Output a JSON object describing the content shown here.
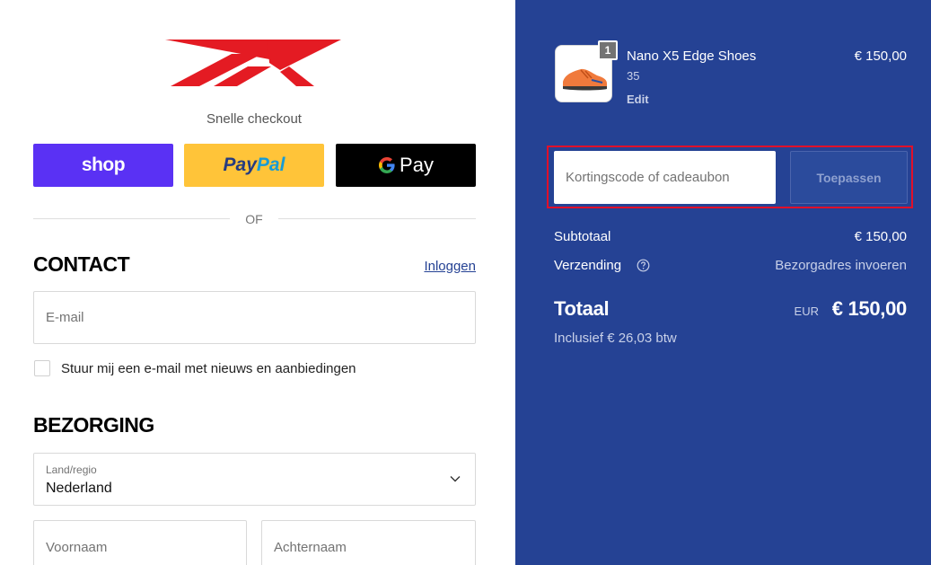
{
  "header": {
    "brand": "Reebok",
    "fast_checkout_label": "Snelle checkout"
  },
  "express_pay": {
    "shop_label": "shop",
    "paypal_label_a": "Pay",
    "paypal_label_b": "Pal",
    "gpay_label": "Pay",
    "or_label": "OF",
    "colors": {
      "shop": "#5a31f4",
      "paypal": "#ffc439",
      "gpay": "#000000"
    }
  },
  "contact": {
    "title": "CONTACT",
    "login_label": "Inloggen",
    "email_placeholder": "E-mail",
    "newsletter_label": "Stuur mij een e-mail met nieuws en aanbiedingen"
  },
  "delivery": {
    "title": "BEZORGING",
    "country_label": "Land/regio",
    "country_value": "Nederland",
    "firstname_placeholder": "Voornaam",
    "lastname_placeholder": "Achternaam"
  },
  "order": {
    "item": {
      "name": "Nano X5 Edge Shoes",
      "variant": "35",
      "edit_label": "Edit",
      "price": "€ 150,00",
      "quantity": "1"
    },
    "discount": {
      "placeholder": "Kortingscode of cadeaubon",
      "apply_label": "Toepassen"
    },
    "subtotal_label": "Subtotaal",
    "subtotal_value": "€ 150,00",
    "shipping_label": "Verzending",
    "shipping_value": "Bezorgadres invoeren",
    "total_label": "Totaal",
    "total_currency": "EUR",
    "total_value": "€ 150,00",
    "tax_line": "Inclusief € 26,03 btw"
  },
  "colors": {
    "sidebar_bg": "#254294",
    "highlight": "#e0102a",
    "brand_red": "#e41b23"
  }
}
